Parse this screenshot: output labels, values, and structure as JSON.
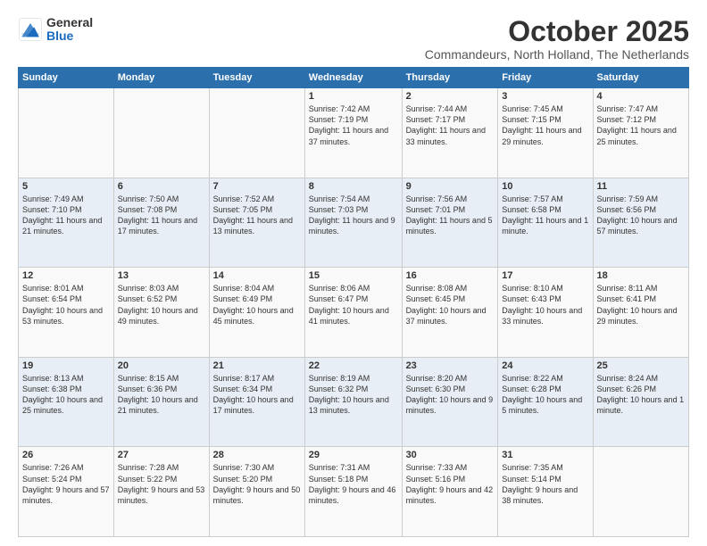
{
  "header": {
    "logo_general": "General",
    "logo_blue": "Blue",
    "month_title": "October 2025",
    "location": "Commandeurs, North Holland, The Netherlands"
  },
  "weekdays": [
    "Sunday",
    "Monday",
    "Tuesday",
    "Wednesday",
    "Thursday",
    "Friday",
    "Saturday"
  ],
  "weeks": [
    [
      {
        "day": "",
        "info": ""
      },
      {
        "day": "",
        "info": ""
      },
      {
        "day": "",
        "info": ""
      },
      {
        "day": "1",
        "info": "Sunrise: 7:42 AM\nSunset: 7:19 PM\nDaylight: 11 hours and 37 minutes."
      },
      {
        "day": "2",
        "info": "Sunrise: 7:44 AM\nSunset: 7:17 PM\nDaylight: 11 hours and 33 minutes."
      },
      {
        "day": "3",
        "info": "Sunrise: 7:45 AM\nSunset: 7:15 PM\nDaylight: 11 hours and 29 minutes."
      },
      {
        "day": "4",
        "info": "Sunrise: 7:47 AM\nSunset: 7:12 PM\nDaylight: 11 hours and 25 minutes."
      }
    ],
    [
      {
        "day": "5",
        "info": "Sunrise: 7:49 AM\nSunset: 7:10 PM\nDaylight: 11 hours and 21 minutes."
      },
      {
        "day": "6",
        "info": "Sunrise: 7:50 AM\nSunset: 7:08 PM\nDaylight: 11 hours and 17 minutes."
      },
      {
        "day": "7",
        "info": "Sunrise: 7:52 AM\nSunset: 7:05 PM\nDaylight: 11 hours and 13 minutes."
      },
      {
        "day": "8",
        "info": "Sunrise: 7:54 AM\nSunset: 7:03 PM\nDaylight: 11 hours and 9 minutes."
      },
      {
        "day": "9",
        "info": "Sunrise: 7:56 AM\nSunset: 7:01 PM\nDaylight: 11 hours and 5 minutes."
      },
      {
        "day": "10",
        "info": "Sunrise: 7:57 AM\nSunset: 6:58 PM\nDaylight: 11 hours and 1 minute."
      },
      {
        "day": "11",
        "info": "Sunrise: 7:59 AM\nSunset: 6:56 PM\nDaylight: 10 hours and 57 minutes."
      }
    ],
    [
      {
        "day": "12",
        "info": "Sunrise: 8:01 AM\nSunset: 6:54 PM\nDaylight: 10 hours and 53 minutes."
      },
      {
        "day": "13",
        "info": "Sunrise: 8:03 AM\nSunset: 6:52 PM\nDaylight: 10 hours and 49 minutes."
      },
      {
        "day": "14",
        "info": "Sunrise: 8:04 AM\nSunset: 6:49 PM\nDaylight: 10 hours and 45 minutes."
      },
      {
        "day": "15",
        "info": "Sunrise: 8:06 AM\nSunset: 6:47 PM\nDaylight: 10 hours and 41 minutes."
      },
      {
        "day": "16",
        "info": "Sunrise: 8:08 AM\nSunset: 6:45 PM\nDaylight: 10 hours and 37 minutes."
      },
      {
        "day": "17",
        "info": "Sunrise: 8:10 AM\nSunset: 6:43 PM\nDaylight: 10 hours and 33 minutes."
      },
      {
        "day": "18",
        "info": "Sunrise: 8:11 AM\nSunset: 6:41 PM\nDaylight: 10 hours and 29 minutes."
      }
    ],
    [
      {
        "day": "19",
        "info": "Sunrise: 8:13 AM\nSunset: 6:38 PM\nDaylight: 10 hours and 25 minutes."
      },
      {
        "day": "20",
        "info": "Sunrise: 8:15 AM\nSunset: 6:36 PM\nDaylight: 10 hours and 21 minutes."
      },
      {
        "day": "21",
        "info": "Sunrise: 8:17 AM\nSunset: 6:34 PM\nDaylight: 10 hours and 17 minutes."
      },
      {
        "day": "22",
        "info": "Sunrise: 8:19 AM\nSunset: 6:32 PM\nDaylight: 10 hours and 13 minutes."
      },
      {
        "day": "23",
        "info": "Sunrise: 8:20 AM\nSunset: 6:30 PM\nDaylight: 10 hours and 9 minutes."
      },
      {
        "day": "24",
        "info": "Sunrise: 8:22 AM\nSunset: 6:28 PM\nDaylight: 10 hours and 5 minutes."
      },
      {
        "day": "25",
        "info": "Sunrise: 8:24 AM\nSunset: 6:26 PM\nDaylight: 10 hours and 1 minute."
      }
    ],
    [
      {
        "day": "26",
        "info": "Sunrise: 7:26 AM\nSunset: 5:24 PM\nDaylight: 9 hours and 57 minutes."
      },
      {
        "day": "27",
        "info": "Sunrise: 7:28 AM\nSunset: 5:22 PM\nDaylight: 9 hours and 53 minutes."
      },
      {
        "day": "28",
        "info": "Sunrise: 7:30 AM\nSunset: 5:20 PM\nDaylight: 9 hours and 50 minutes."
      },
      {
        "day": "29",
        "info": "Sunrise: 7:31 AM\nSunset: 5:18 PM\nDaylight: 9 hours and 46 minutes."
      },
      {
        "day": "30",
        "info": "Sunrise: 7:33 AM\nSunset: 5:16 PM\nDaylight: 9 hours and 42 minutes."
      },
      {
        "day": "31",
        "info": "Sunrise: 7:35 AM\nSunset: 5:14 PM\nDaylight: 9 hours and 38 minutes."
      },
      {
        "day": "",
        "info": ""
      }
    ]
  ]
}
